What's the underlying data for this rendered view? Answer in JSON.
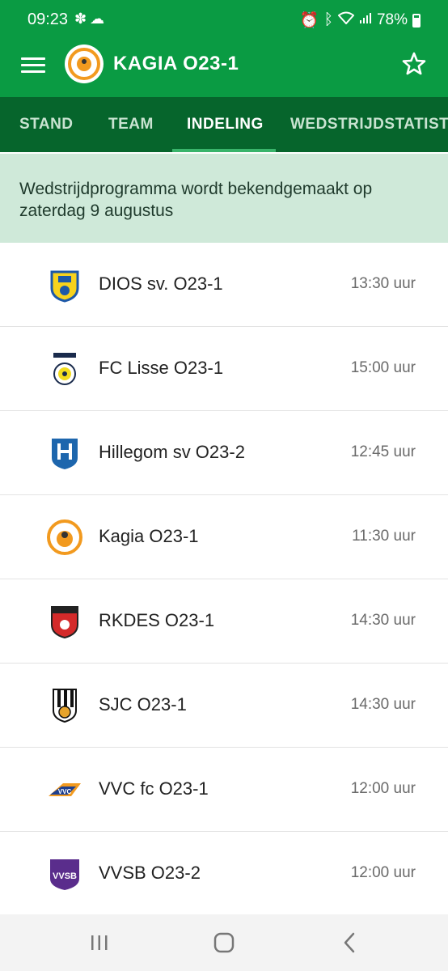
{
  "status_bar": {
    "time": "09:23",
    "battery": "78%"
  },
  "app_bar": {
    "title": "KAGIA O23-1"
  },
  "tabs": [
    {
      "label": "STAND",
      "active": false
    },
    {
      "label": "TEAM",
      "active": false
    },
    {
      "label": "INDELING",
      "active": true
    },
    {
      "label": "WEDSTRIJDSTATISTIEK",
      "active": false
    }
  ],
  "notice": {
    "text": "Wedstrijdprogramma wordt bekendgemaakt op zaterdag 9 augustus"
  },
  "teams": [
    {
      "name": "DIOS sv. O23-1",
      "time": "13:30 uur",
      "logo": "dios-logo"
    },
    {
      "name": "FC Lisse O23-1",
      "time": "15:00 uur",
      "logo": "fc-lisse-logo"
    },
    {
      "name": "Hillegom sv O23-2",
      "time": "12:45 uur",
      "logo": "hillegom-logo"
    },
    {
      "name": "Kagia O23-1",
      "time": "11:30 uur",
      "logo": "kagia-logo"
    },
    {
      "name": "RKDES O23-1",
      "time": "14:30 uur",
      "logo": "rkdes-logo"
    },
    {
      "name": "SJC O23-1",
      "time": "14:30 uur",
      "logo": "sjc-logo"
    },
    {
      "name": "VVC fc O23-1",
      "time": "12:00 uur",
      "logo": "vvc-logo"
    },
    {
      "name": "VVSB O23-2",
      "time": "12:00 uur",
      "logo": "vvsb-logo"
    }
  ],
  "colors": {
    "brand_green": "#0a9b43",
    "tab_bar": "#06652c",
    "notice_bg": "#cfe9d9"
  }
}
